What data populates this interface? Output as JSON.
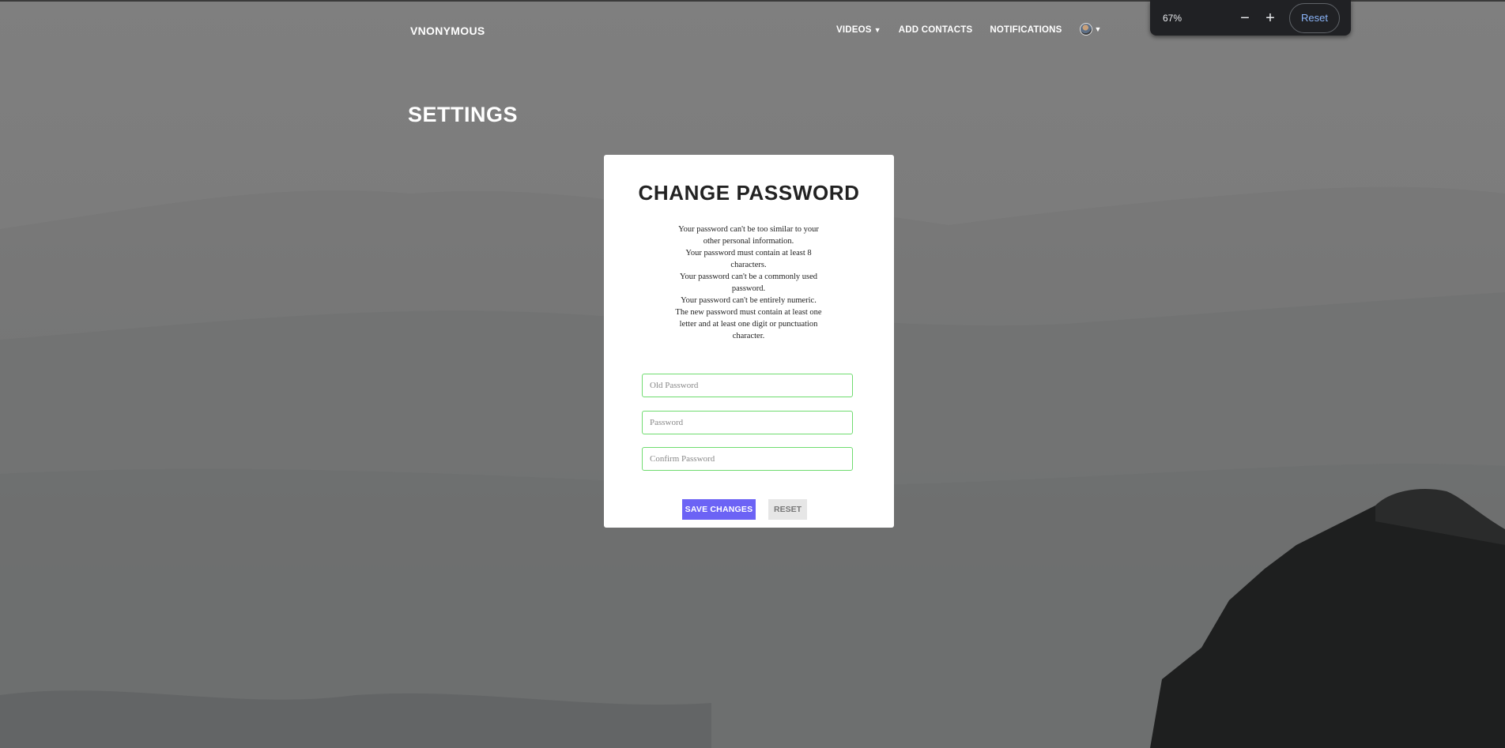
{
  "brand": "VNONYMOUS",
  "nav": {
    "videos": "VIDEOS",
    "videos_caret": "▼",
    "add_contacts": "ADD CONTACTS",
    "notifications": "NOTIFICATIONS",
    "profile_caret": "▼"
  },
  "zoom": {
    "level": "67%",
    "minus": "−",
    "plus": "+",
    "reset": "Reset"
  },
  "page_title": "SETTINGS",
  "card": {
    "title": "CHANGE PASSWORD",
    "rules": [
      "Your password can't be too similar to your other personal information.",
      "Your password must contain at least 8 characters.",
      "Your password can't be a commonly used password.",
      "Your password can't be entirely numeric.",
      "The new password must contain at least one letter and at least one digit or punctuation character."
    ],
    "fields": {
      "old_password_placeholder": "Old Password",
      "password_placeholder": "Password",
      "confirm_password_placeholder": "Confirm Password"
    },
    "save_label": "SAVE CHANGES",
    "reset_label": "RESET"
  },
  "colors": {
    "accent": "#6c63f5",
    "field_border": "#6fdc6f",
    "zoom_bg": "#202124",
    "zoom_link": "#8ab4f8"
  },
  "icons": [
    "profile-avatar",
    "minus-icon",
    "plus-icon",
    "caret-down-icon"
  ]
}
